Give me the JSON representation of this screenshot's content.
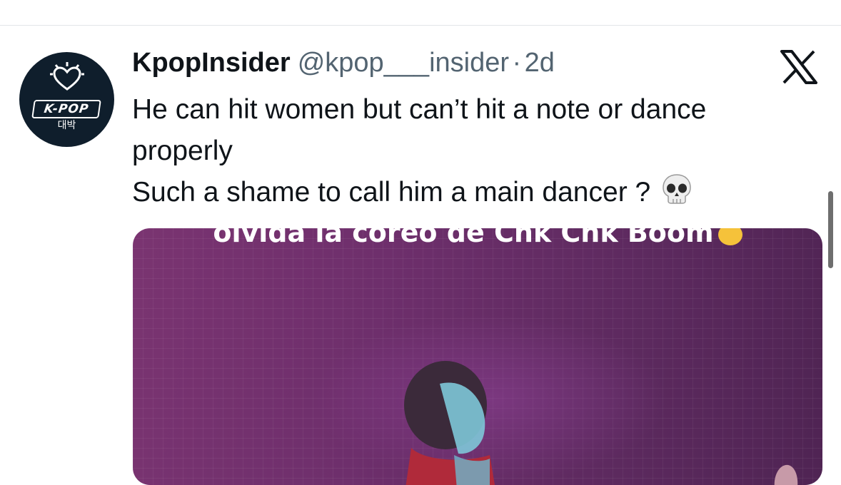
{
  "tweet": {
    "author": {
      "display_name": "KpopInsider",
      "handle": "@kpop___insider",
      "avatar": {
        "logo_text": "K-POP",
        "logo_subtext": "대박",
        "icon": "heart-icon"
      }
    },
    "separator": "·",
    "time_ago": "2d",
    "text_lines": [
      "He can hit women but can’t hit a note or dance",
      "properly",
      "Such a shame to call him a main dancer ?"
    ],
    "emoji": "skull-icon",
    "media": {
      "caption": "olvida la coreo de Chk Chk Boom",
      "caption_emoji": "laughing-face-icon"
    }
  },
  "platform_icon": "x-logo-icon",
  "colors": {
    "text_primary": "#0f1419",
    "text_secondary": "#536471",
    "avatar_bg": "#0f1e2c",
    "media_bg": "#6e2f6c"
  }
}
